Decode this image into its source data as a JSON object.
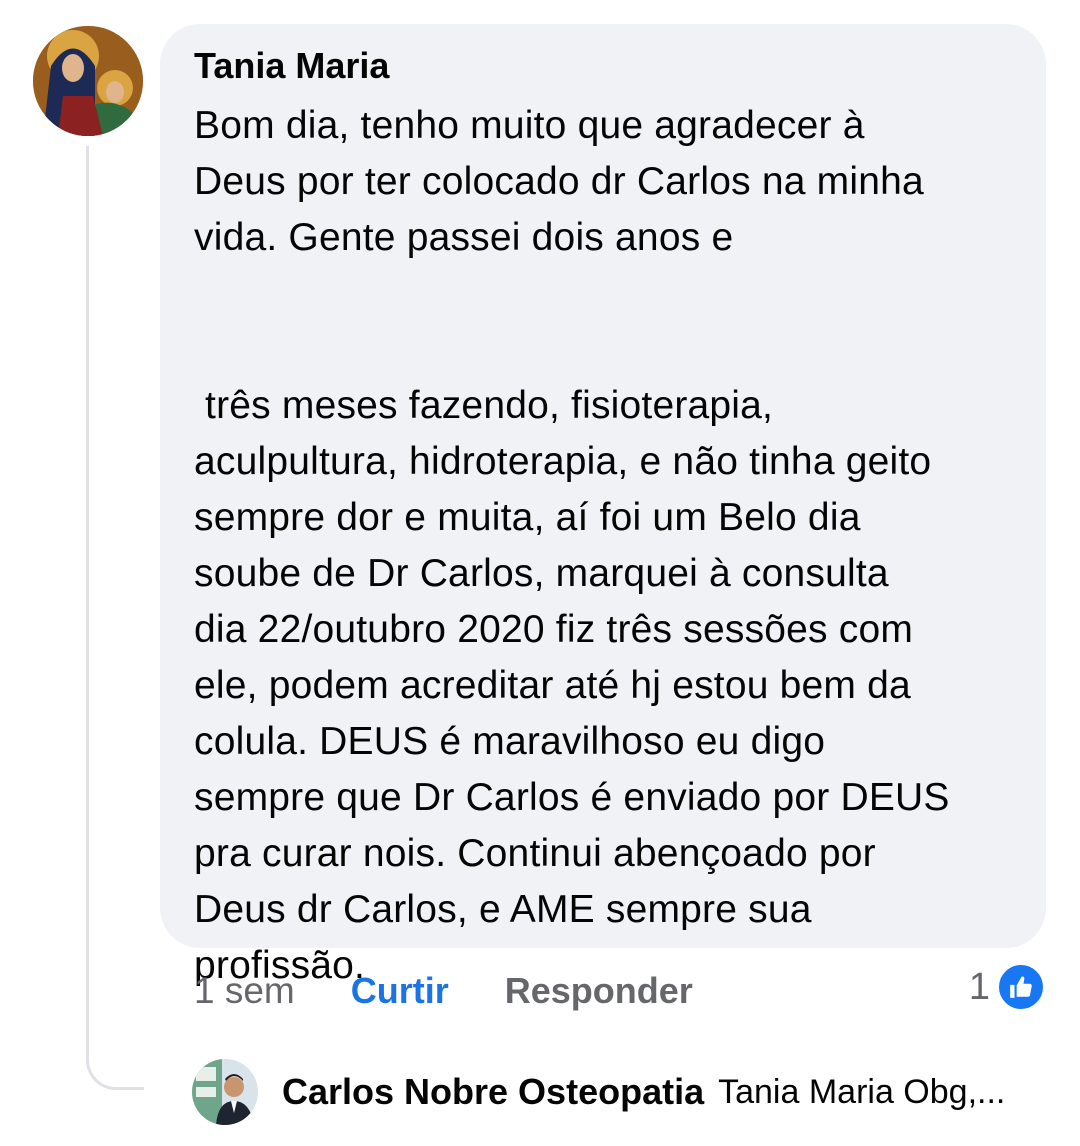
{
  "comment": {
    "author": "Tania Maria",
    "text": "Bom dia, tenho muito que agradecer à\nDeus por ter colocado dr Carlos na minha\nvida. Gente passei dois anos e\n\n\n três meses fazendo, fisioterapia,\naculpultura, hidroterapia, e não tinha geito\nsempre dor e muita, aí foi um Belo dia\nsoube de Dr Carlos, marquei à consulta\ndia 22/outubro 2020 fiz três sessões com\nele, podem acreditar até hj estou bem da\ncolula. DEUS é maravilhoso eu digo\nsempre que Dr Carlos é enviado por DEUS\npra curar nois. Continui abençoado por\nDeus dr Carlos, e AME sempre sua\nprofissão.",
    "avatar_icon": "religious-icon-avatar",
    "time": "1 sem",
    "like_label": "Curtir",
    "reply_label": "Responder",
    "reaction_count": "1",
    "reaction_icon": "thumbs-up-icon",
    "accent_color": "#1b74e4"
  },
  "reply": {
    "author": "Carlos Nobre Osteopatia",
    "snippet": "Tania Maria Obg,...",
    "avatar_icon": "profile-photo-avatar"
  }
}
